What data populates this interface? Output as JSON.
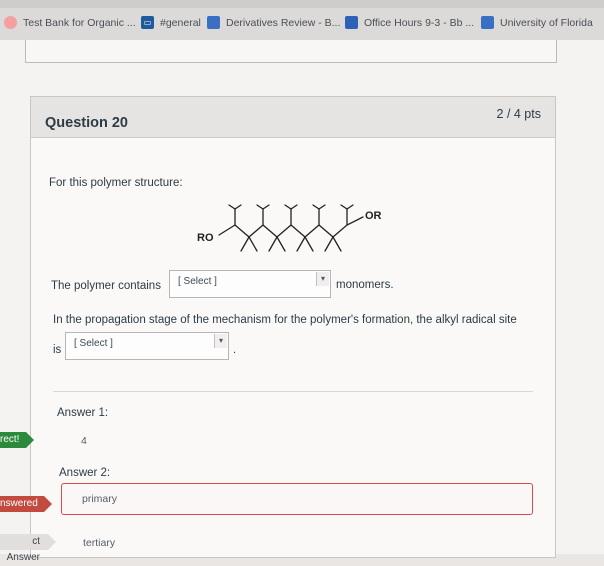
{
  "bookmarks": [
    {
      "label": "Test Bank for Organic ...",
      "icon": "red-circle-icon"
    },
    {
      "label": "#general",
      "icon": "chat-icon"
    },
    {
      "label": "Derivatives Review - B...",
      "icon": "blue-square-icon"
    },
    {
      "label": "Office Hours 9-3 - Bb ...",
      "icon": "blue-square-icon"
    },
    {
      "label": "University of Florida ",
      "icon": "blue-square-icon"
    }
  ],
  "question": {
    "title": "Question 20",
    "points": "2 / 4 pts",
    "prompt": "For this polymer structure:",
    "molecule": {
      "left_label": "RO",
      "right_label": "OR"
    },
    "sentence1_before": "The polymer contains",
    "select1_value": "[ Select ]",
    "sentence1_after": "monomers.",
    "sentence2": "In the propagation stage of the mechanism for the polymer's formation, the alkyl radical site",
    "sentence2_before": "is",
    "select2_value": "[ Select ]",
    "sentence2_after": "."
  },
  "answers": {
    "answer1_label": "Answer 1:",
    "answer1_value": "4",
    "answer2_label": "Answer 2:",
    "answer2_value": "primary",
    "correct_answer_value": "tertiary"
  },
  "flags": {
    "correct": "rect!",
    "incorrect": "nswered",
    "correct_answer": "ct Answer"
  },
  "colors": {
    "correct": "#2c8a3d",
    "incorrect": "#c24a3f",
    "header_bg": "#e6e4e3"
  }
}
